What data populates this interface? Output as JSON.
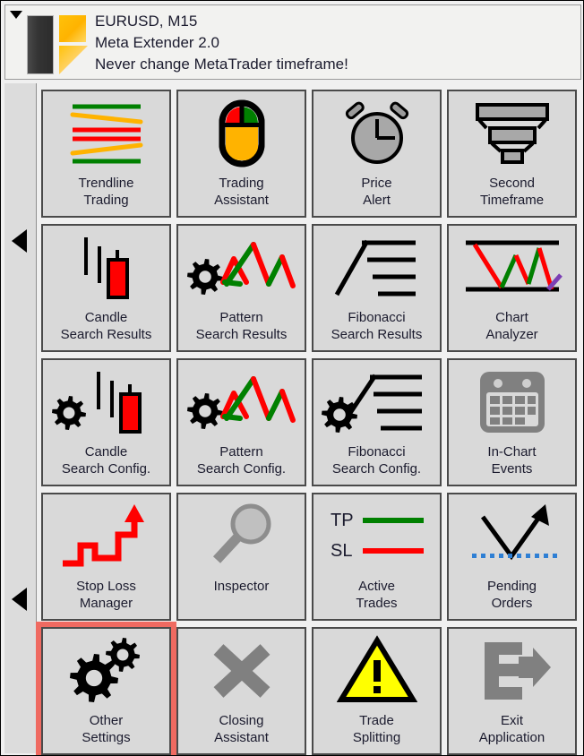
{
  "header": {
    "symbol_timeframe": "EURUSD, M15",
    "product": "Meta Extender 2.0",
    "warning": "Never change MetaTrader timeframe!",
    "collapse_icon": "caret-down-icon",
    "logo_icon": "meta-extender-logo"
  },
  "rail": {
    "arrow_top_icon": "caret-left-icon",
    "arrow_bottom_icon": "caret-left-icon"
  },
  "colors": {
    "selection": "#ef6a61",
    "accent_orange": "#ffb300",
    "bull_green": "#008000",
    "bear_red": "#ff0000",
    "disabled_gray": "#808080",
    "warning_yellow": "#ffff00",
    "purple": "#7b3fb5",
    "pending_blue": "#2e7fd4",
    "tile_bg": "#d9d9d9",
    "panel_bg": "#f0f0f0"
  },
  "tiles": [
    {
      "id": "trendline-trading",
      "label": "Trendline\nTrading",
      "icon": "trendlines-icon",
      "selected": false,
      "disabled": false
    },
    {
      "id": "trading-assistant",
      "label": "Trading\nAssistant",
      "icon": "mouse-icon",
      "selected": false,
      "disabled": false
    },
    {
      "id": "price-alert",
      "label": "Price\nAlert",
      "icon": "alarm-clock-icon",
      "selected": false,
      "disabled": false
    },
    {
      "id": "second-timeframe",
      "label": "Second\nTimeframe",
      "icon": "funnel-candles-icon",
      "selected": false,
      "disabled": false
    },
    {
      "id": "candle-search-results",
      "label": "Candle\nSearch Results",
      "icon": "candlestick-icon",
      "selected": false,
      "disabled": false
    },
    {
      "id": "pattern-search-results",
      "label": "Pattern\nSearch Results",
      "icon": "zigzag-gear-icon",
      "selected": false,
      "disabled": false
    },
    {
      "id": "fibonacci-search-results",
      "label": "Fibonacci\nSearch Results",
      "icon": "fibonacci-icon",
      "selected": false,
      "disabled": false
    },
    {
      "id": "chart-analyzer",
      "label": "Chart\nAnalyzer",
      "icon": "chart-analyzer-icon",
      "selected": false,
      "disabled": false
    },
    {
      "id": "candle-search-config",
      "label": "Candle\nSearch Config.",
      "icon": "candlestick-gear-icon",
      "selected": false,
      "disabled": false
    },
    {
      "id": "pattern-search-config",
      "label": "Pattern\nSearch Config.",
      "icon": "zigzag-gear-icon",
      "selected": false,
      "disabled": false
    },
    {
      "id": "fibonacci-search-config",
      "label": "Fibonacci\nSearch Config.",
      "icon": "fibonacci-gear-icon",
      "selected": false,
      "disabled": false
    },
    {
      "id": "in-chart-events",
      "label": "In-Chart\nEvents",
      "icon": "calendar-icon",
      "selected": false,
      "disabled": true
    },
    {
      "id": "stop-loss-manager",
      "label": "Stop Loss\nManager",
      "icon": "staircase-arrow-icon",
      "selected": false,
      "disabled": false
    },
    {
      "id": "inspector",
      "label": "Inspector",
      "icon": "magnifier-icon",
      "selected": false,
      "disabled": false
    },
    {
      "id": "active-trades",
      "label": "Active\nTrades",
      "icon": "tp-sl-icon",
      "selected": false,
      "disabled": false
    },
    {
      "id": "pending-orders",
      "label": "Pending\nOrders",
      "icon": "pending-arrow-icon",
      "selected": false,
      "disabled": false
    },
    {
      "id": "other-settings",
      "label": "Other\nSettings",
      "icon": "gears-icon",
      "selected": true,
      "disabled": false
    },
    {
      "id": "closing-assistant",
      "label": "Closing\nAssistant",
      "icon": "x-cross-icon",
      "selected": false,
      "disabled": true
    },
    {
      "id": "trade-splitting",
      "label": "Trade\nSplitting",
      "icon": "warning-triangle-icon",
      "selected": false,
      "disabled": false
    },
    {
      "id": "exit-application",
      "label": "Exit\nApplication",
      "icon": "exit-icon",
      "selected": false,
      "disabled": true
    }
  ],
  "icon_text": {
    "tp": "TP",
    "sl": "SL"
  }
}
